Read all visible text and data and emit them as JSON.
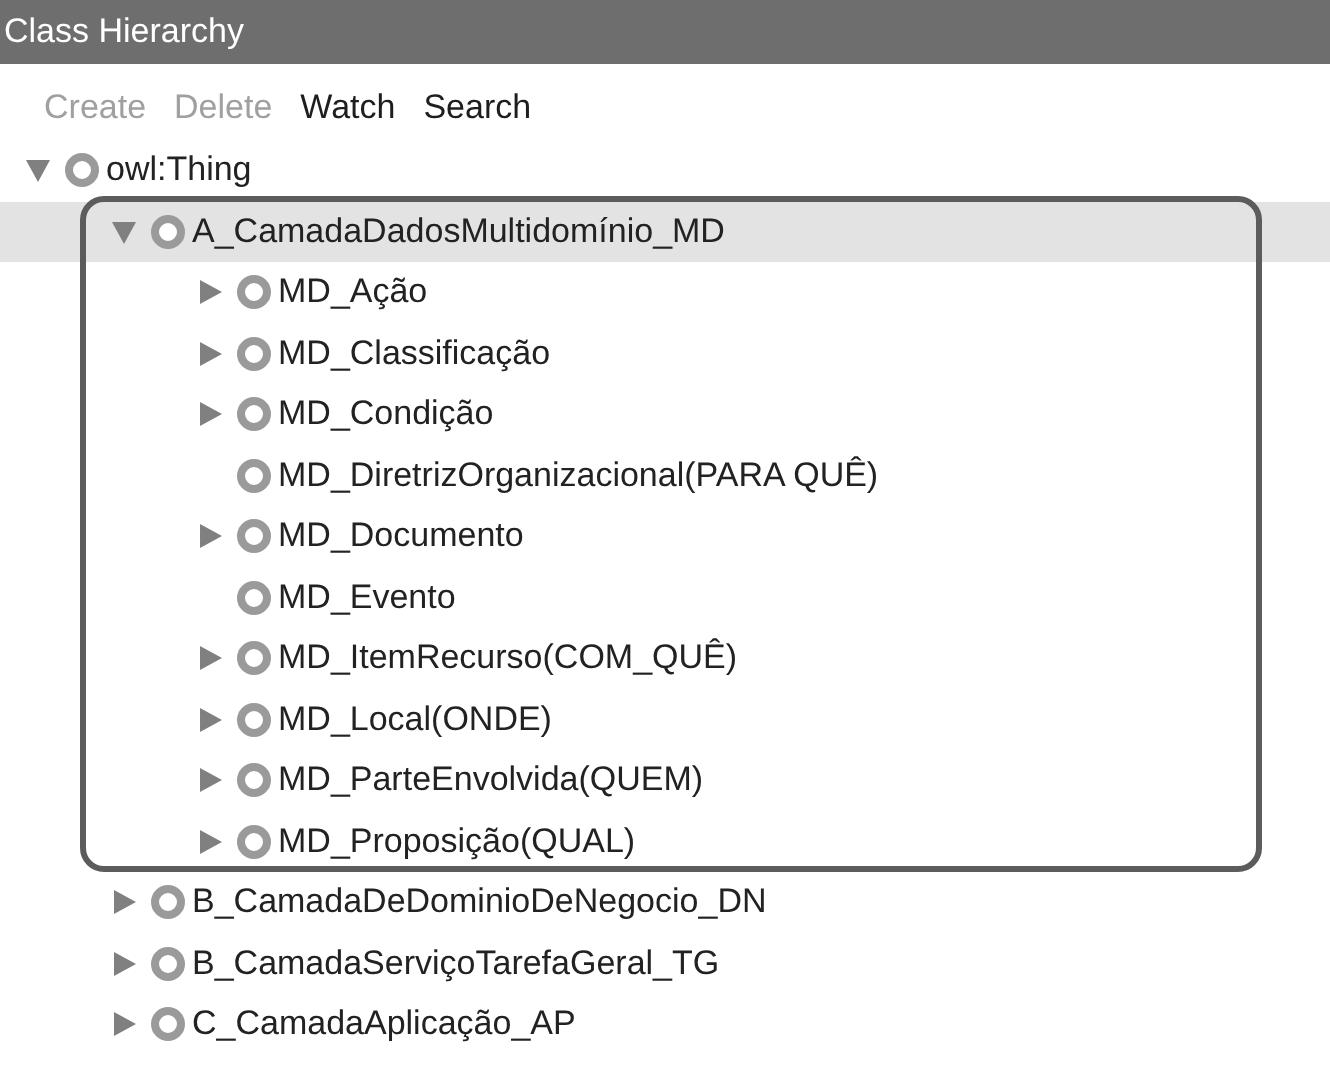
{
  "window": {
    "title": "Class Hierarchy"
  },
  "toolbar": [
    {
      "label": "Create",
      "disabled": true
    },
    {
      "label": "Delete",
      "disabled": true
    },
    {
      "label": "Watch",
      "disabled": false
    },
    {
      "label": "Search",
      "disabled": false
    }
  ],
  "tree": [
    {
      "label": "owl:Thing",
      "kind": "branch",
      "expanded": true,
      "selected": false,
      "children": [
        {
          "label": "A_CamadaDadosMultidomínio_MD",
          "kind": "branch",
          "expanded": true,
          "selected": true,
          "children": [
            {
              "label": "MD_Ação",
              "kind": "branch",
              "expanded": false,
              "selected": false
            },
            {
              "label": "MD_Classificação",
              "kind": "branch",
              "expanded": false,
              "selected": false
            },
            {
              "label": "MD_Condição",
              "kind": "branch",
              "expanded": false,
              "selected": false
            },
            {
              "label": "MD_DiretrizOrganizacional(PARA QUÊ)",
              "kind": "leaf",
              "selected": false
            },
            {
              "label": "MD_Documento",
              "kind": "branch",
              "expanded": false,
              "selected": false
            },
            {
              "label": "MD_Evento",
              "kind": "leaf",
              "selected": false
            },
            {
              "label": "MD_ItemRecurso(COM_QUÊ)",
              "kind": "branch",
              "expanded": false,
              "selected": false
            },
            {
              "label": "MD_Local(ONDE)",
              "kind": "branch",
              "expanded": false,
              "selected": false
            },
            {
              "label": "MD_ParteEnvolvida(QUEM)",
              "kind": "branch",
              "expanded": false,
              "selected": false
            },
            {
              "label": "MD_Proposição(QUAL)",
              "kind": "branch",
              "expanded": false,
              "selected": false
            }
          ]
        },
        {
          "label": "B_CamadaDeDominioDeNegocio_DN",
          "kind": "branch",
          "expanded": false,
          "selected": false
        },
        {
          "label": "B_CamadaServiçoTarefaGeral_TG",
          "kind": "branch",
          "expanded": false,
          "selected": false
        },
        {
          "label": "C_CamadaAplicação_AP",
          "kind": "branch",
          "expanded": false,
          "selected": false
        }
      ]
    }
  ]
}
